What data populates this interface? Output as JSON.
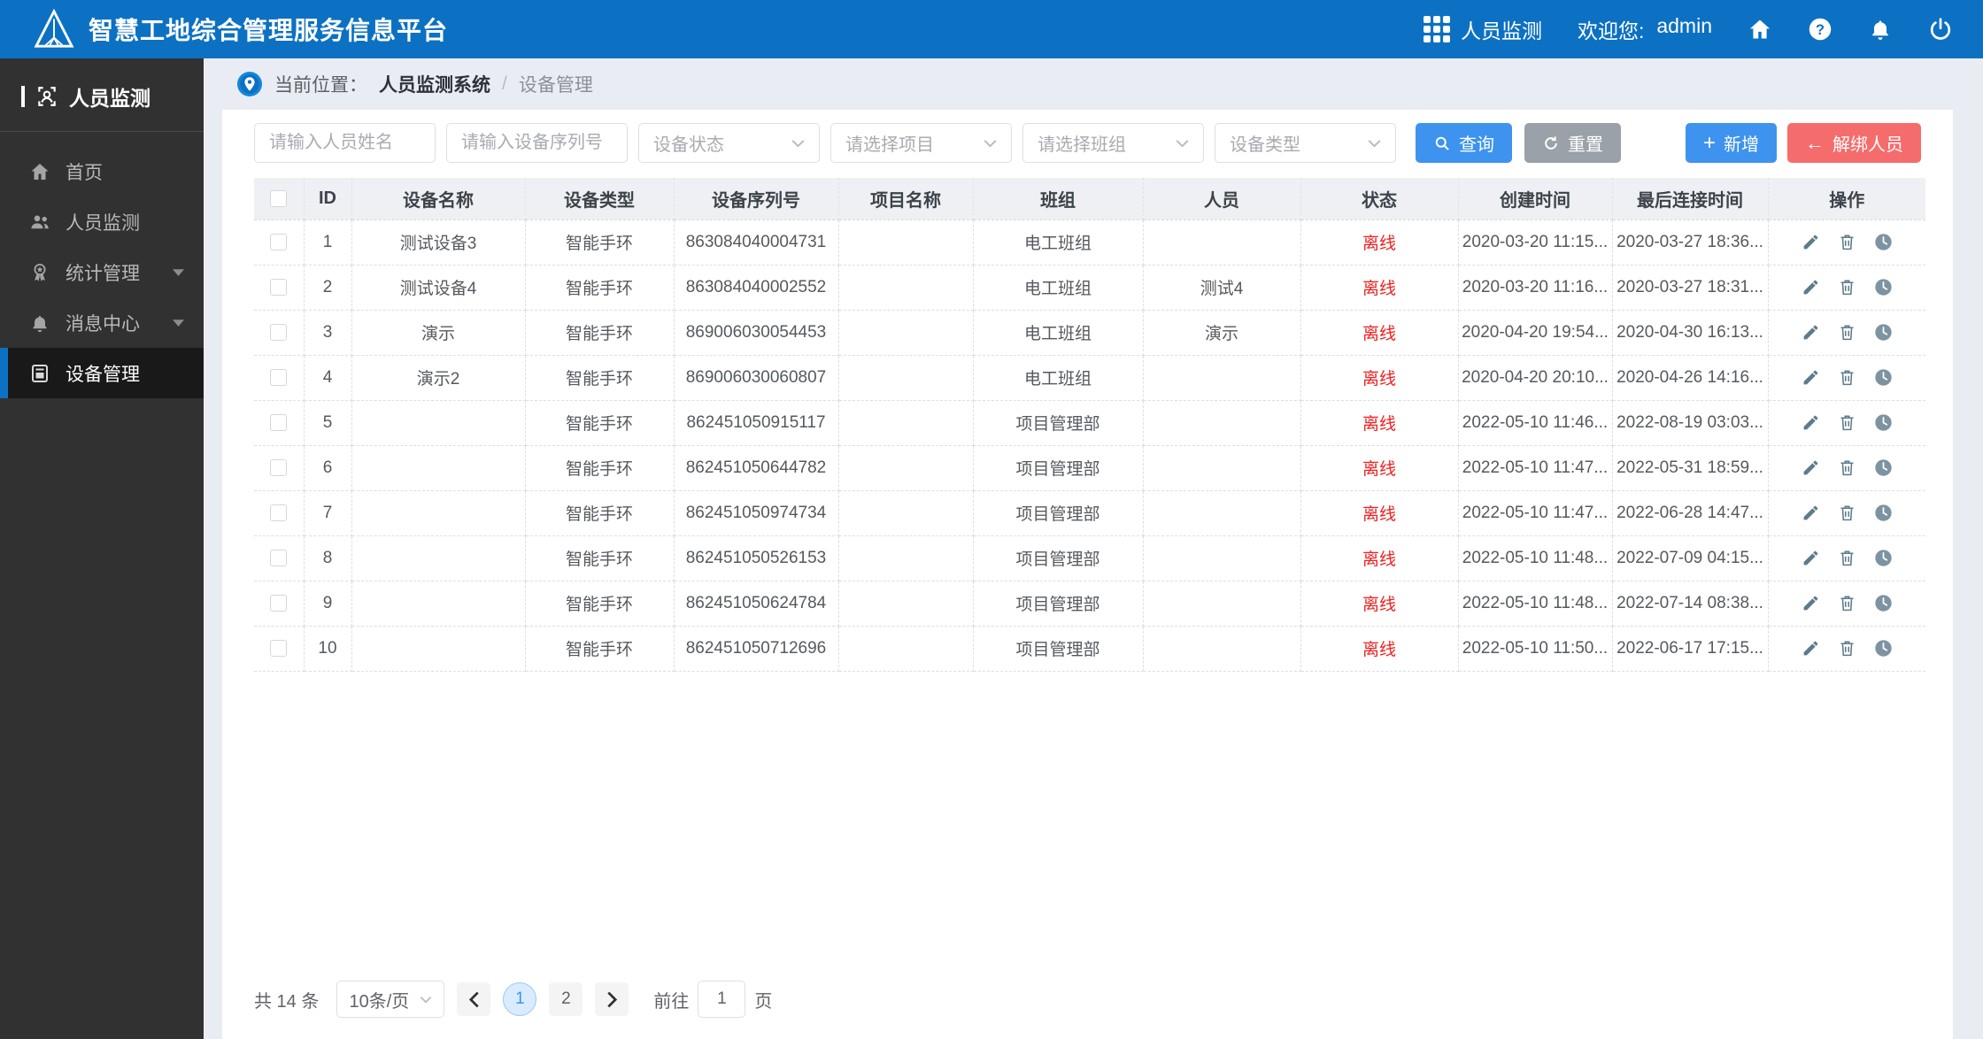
{
  "header": {
    "app_title": "智慧工地综合管理服务信息平台",
    "switcher_label": "人员监测",
    "welcome_label": "欢迎您:",
    "username": "admin",
    "colors": {
      "header_bg": "#0c71c3"
    }
  },
  "sidebar": {
    "section_title": "人员监测",
    "items": [
      {
        "label": "首页",
        "icon": "home-icon",
        "active": false,
        "expandable": false
      },
      {
        "label": "人员监测",
        "icon": "users-icon",
        "active": false,
        "expandable": false
      },
      {
        "label": "统计管理",
        "icon": "badge-icon",
        "active": false,
        "expandable": true
      },
      {
        "label": "消息中心",
        "icon": "bell-icon",
        "active": false,
        "expandable": true
      },
      {
        "label": "设备管理",
        "icon": "device-icon",
        "active": true,
        "expandable": false
      }
    ]
  },
  "breadcrumb": {
    "prefix": "当前位置：",
    "root": "人员监测系统",
    "separator": "/",
    "current": "设备管理"
  },
  "filters": {
    "name_placeholder": "请输入人员姓名",
    "serial_placeholder": "请输入设备序列号",
    "selects": [
      "设备状态",
      "请选择项目",
      "请选择班组",
      "设备类型"
    ],
    "search_label": "查询",
    "reset_label": "重置"
  },
  "actions": {
    "add_label": "新增",
    "unbind_label": "解绑人员",
    "add_color": "#3d93ee",
    "unbind_color": "#f56c6c"
  },
  "table": {
    "columns": [
      "ID",
      "设备名称",
      "设备类型",
      "设备序列号",
      "项目名称",
      "班组",
      "人员",
      "状态",
      "创建时间",
      "最后连接时间",
      "操作"
    ],
    "status_color": "#f02020",
    "rows": [
      {
        "id": "1",
        "name": "测试设备3",
        "type": "智能手环",
        "serial": "863084040004731",
        "project": "",
        "team": "电工班组",
        "person": "",
        "status": "离线",
        "created": "2020-03-20 11:15...",
        "last_conn": "2020-03-27 18:36..."
      },
      {
        "id": "2",
        "name": "测试设备4",
        "type": "智能手环",
        "serial": "863084040002552",
        "project": "",
        "team": "电工班组",
        "person": "测试4",
        "status": "离线",
        "created": "2020-03-20 11:16...",
        "last_conn": "2020-03-27 18:31..."
      },
      {
        "id": "3",
        "name": "演示",
        "type": "智能手环",
        "serial": "869006030054453",
        "project": "",
        "team": "电工班组",
        "person": "演示",
        "status": "离线",
        "created": "2020-04-20 19:54...",
        "last_conn": "2020-04-30 16:13..."
      },
      {
        "id": "4",
        "name": "演示2",
        "type": "智能手环",
        "serial": "869006030060807",
        "project": "",
        "team": "电工班组",
        "person": "",
        "status": "离线",
        "created": "2020-04-20 20:10...",
        "last_conn": "2020-04-26 14:16..."
      },
      {
        "id": "5",
        "name": "",
        "type": "智能手环",
        "serial": "862451050915117",
        "project": "",
        "team": "项目管理部",
        "person": "",
        "status": "离线",
        "created": "2022-05-10 11:46...",
        "last_conn": "2022-08-19 03:03..."
      },
      {
        "id": "6",
        "name": "",
        "type": "智能手环",
        "serial": "862451050644782",
        "project": "",
        "team": "项目管理部",
        "person": "",
        "status": "离线",
        "created": "2022-05-10 11:47...",
        "last_conn": "2022-05-31 18:59..."
      },
      {
        "id": "7",
        "name": "",
        "type": "智能手环",
        "serial": "862451050974734",
        "project": "",
        "team": "项目管理部",
        "person": "",
        "status": "离线",
        "created": "2022-05-10 11:47...",
        "last_conn": "2022-06-28 14:47..."
      },
      {
        "id": "8",
        "name": "",
        "type": "智能手环",
        "serial": "862451050526153",
        "project": "",
        "team": "项目管理部",
        "person": "",
        "status": "离线",
        "created": "2022-05-10 11:48...",
        "last_conn": "2022-07-09 04:15..."
      },
      {
        "id": "9",
        "name": "",
        "type": "智能手环",
        "serial": "862451050624784",
        "project": "",
        "team": "项目管理部",
        "person": "",
        "status": "离线",
        "created": "2022-05-10 11:48...",
        "last_conn": "2022-07-14 08:38..."
      },
      {
        "id": "10",
        "name": "",
        "type": "智能手环",
        "serial": "862451050712696",
        "project": "",
        "team": "项目管理部",
        "person": "",
        "status": "离线",
        "created": "2022-05-10 11:50...",
        "last_conn": "2022-06-17 17:15..."
      }
    ]
  },
  "pagination": {
    "total_text": "共 14 条",
    "page_size": "10条/页",
    "pages": [
      "1",
      "2"
    ],
    "current_page": "1",
    "goto_prefix": "前往",
    "goto_value": "1",
    "goto_suffix": "页"
  }
}
